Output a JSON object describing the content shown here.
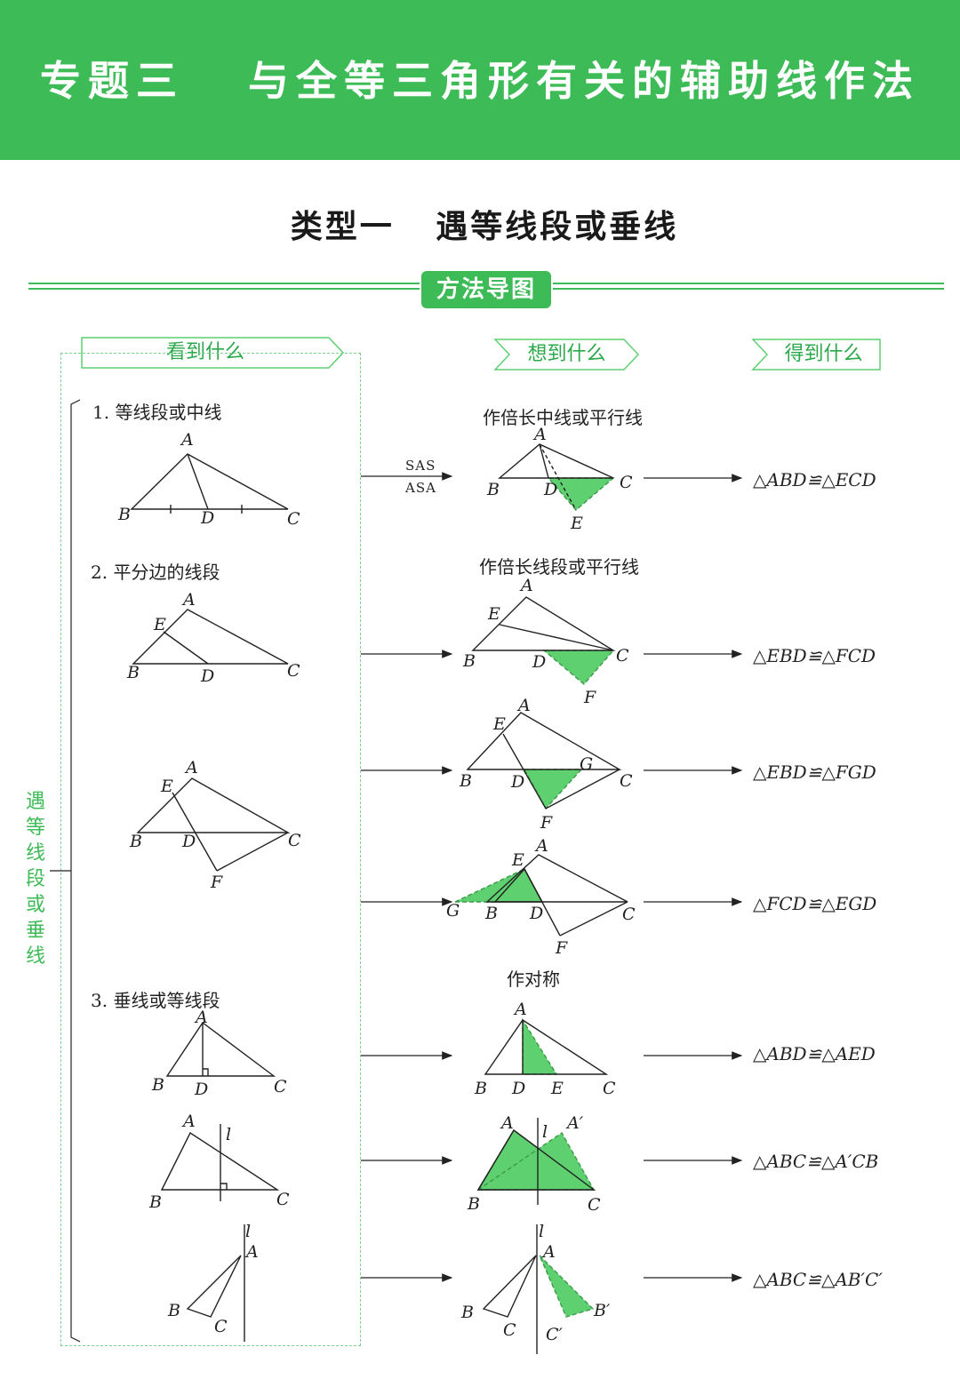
{
  "header": {
    "title": "专题三   与全等三角形有关的辅助线作法",
    "subtitle": "类型一   遇等线段或垂线",
    "badge": "方法导图"
  },
  "columns": {
    "see": "看到什么",
    "think": "想到什么",
    "get": "得到什么"
  },
  "side_label": "遇等线段或垂线",
  "sections": [
    {
      "heading": "1. 等线段或中线",
      "method": "作倍长中线或平行线"
    },
    {
      "heading": "2. 平分边的线段",
      "method": "作倍长线段或平行线"
    },
    {
      "heading": "3. 垂线或等线段",
      "method": "作对称"
    }
  ],
  "arrow_labels": {
    "top": "SAS",
    "bottom": "ASA"
  },
  "results": [
    "△ABD≌△ECD",
    "△EBD≌△FCD",
    "△EBD≌△FGD",
    "△FCD≌△EGD",
    "△ABD≌△AED",
    "△ABC≌△A′CB",
    "△ABC≌△AB′C′"
  ],
  "colors": {
    "accent": "#3dbb57",
    "fill": "#5fd070",
    "text": "#222222"
  }
}
